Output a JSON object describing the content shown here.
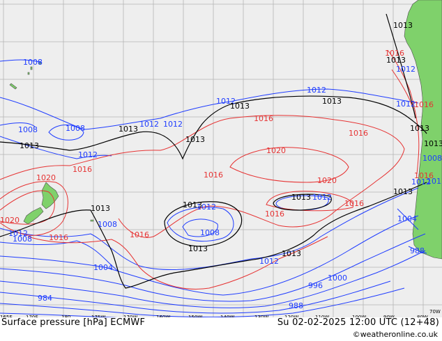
{
  "title": "Surface pressure [hPa] ECMWF",
  "datetime": "Su 02-02-2025 12:00 UTC (12+48)",
  "credit": "©weatheronline.co.uk",
  "colors": {
    "ocean": "#eeeeee",
    "land": "#7fd16b",
    "grid": "#b4b4b4",
    "isobar_low": "#1e3cff",
    "isobar_high": "#e63232",
    "isobar_1013": "#000000"
  },
  "longitude_ticks": [
    "165E",
    "170E",
    "180",
    "175W",
    "170W",
    "160W",
    "150W",
    "140W",
    "130W",
    "120W",
    "110W",
    "100W",
    "90W",
    "80W",
    "70W"
  ],
  "isobar_labels": [
    {
      "text": "1008",
      "color": "blue"
    },
    {
      "text": "1008",
      "color": "blue"
    },
    {
      "text": "1008",
      "color": "blue"
    },
    {
      "text": "1012",
      "color": "blue"
    },
    {
      "text": "1012",
      "color": "blue"
    },
    {
      "text": "1012",
      "color": "blue"
    },
    {
      "text": "1012",
      "color": "blue"
    },
    {
      "text": "1012",
      "color": "blue"
    },
    {
      "text": "1013",
      "color": "black"
    },
    {
      "text": "1013",
      "color": "black"
    },
    {
      "text": "1013",
      "color": "black"
    },
    {
      "text": "1013",
      "color": "black"
    },
    {
      "text": "1013",
      "color": "black"
    },
    {
      "text": "1016",
      "color": "red"
    },
    {
      "text": "1016",
      "color": "red"
    },
    {
      "text": "1016",
      "color": "red"
    },
    {
      "text": "1020",
      "color": "red"
    },
    {
      "text": "1020",
      "color": "red"
    },
    {
      "text": "1020",
      "color": "red"
    },
    {
      "text": "1016",
      "color": "red"
    },
    {
      "text": "1016",
      "color": "red"
    },
    {
      "text": "1013",
      "color": "black"
    },
    {
      "text": "1013",
      "color": "black"
    },
    {
      "text": "1012",
      "color": "blue"
    },
    {
      "text": "1013",
      "color": "black"
    },
    {
      "text": "1012",
      "color": "blue"
    },
    {
      "text": "1008",
      "color": "blue"
    },
    {
      "text": "1013",
      "color": "black"
    },
    {
      "text": "1016",
      "color": "red"
    },
    {
      "text": "1016",
      "color": "red"
    },
    {
      "text": "1012",
      "color": "blue"
    },
    {
      "text": "1008",
      "color": "blue"
    },
    {
      "text": "1013",
      "color": "black"
    },
    {
      "text": "1013",
      "color": "black"
    },
    {
      "text": "1012",
      "color": "blue"
    },
    {
      "text": "1016",
      "color": "red"
    },
    {
      "text": "1016",
      "color": "red"
    },
    {
      "text": "1020",
      "color": "red"
    },
    {
      "text": "1012",
      "color": "blue"
    },
    {
      "text": "1008",
      "color": "blue"
    },
    {
      "text": "1004",
      "color": "blue"
    },
    {
      "text": "1000",
      "color": "blue"
    },
    {
      "text": "996",
      "color": "blue"
    },
    {
      "text": "988",
      "color": "blue"
    },
    {
      "text": "984",
      "color": "blue"
    },
    {
      "text": "988",
      "color": "blue"
    },
    {
      "text": "1004",
      "color": "blue"
    },
    {
      "text": "1012",
      "color": "blue"
    },
    {
      "text": "1013",
      "color": "black"
    },
    {
      "text": "1013",
      "color": "black"
    },
    {
      "text": "1013",
      "color": "black"
    },
    {
      "text": "1016",
      "color": "red"
    },
    {
      "text": "1016",
      "color": "red"
    },
    {
      "text": "1012",
      "color": "blue"
    },
    {
      "text": "1013",
      "color": "black"
    },
    {
      "text": "1008",
      "color": "blue"
    },
    {
      "text": "1012",
      "color": "blue"
    }
  ]
}
